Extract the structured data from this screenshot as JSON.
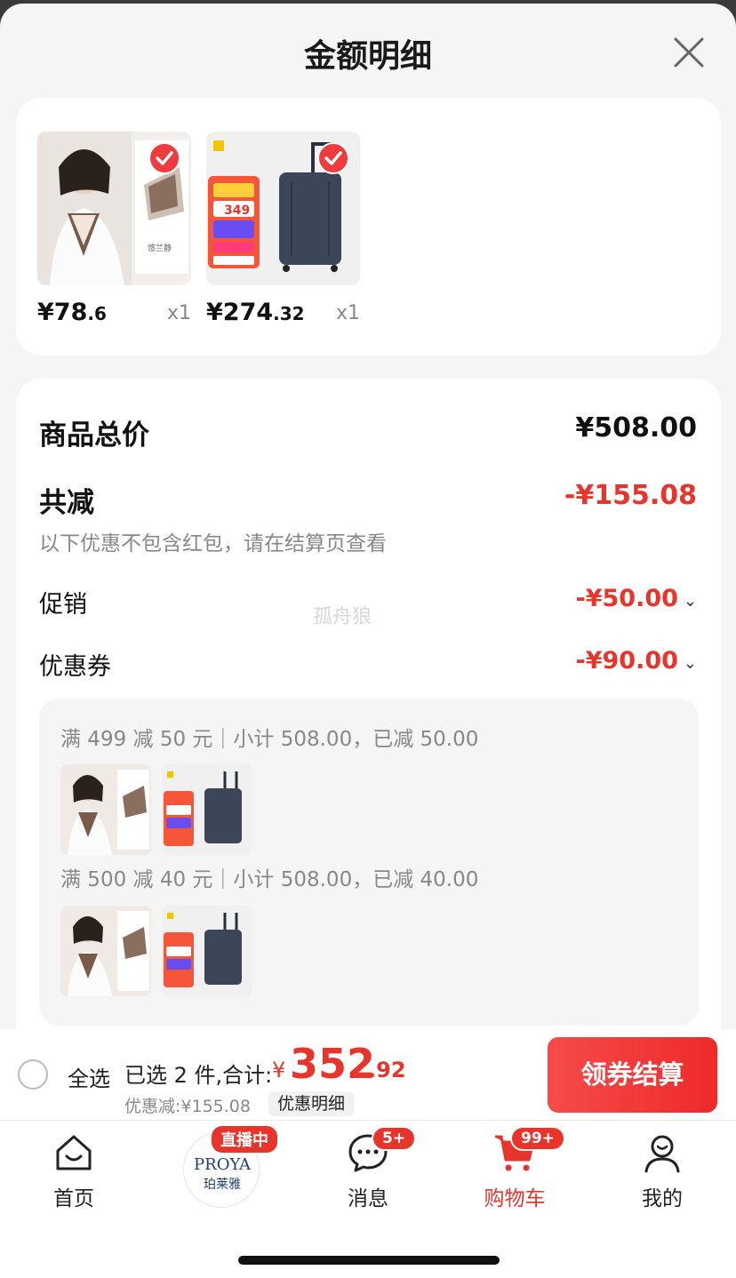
{
  "sheet": {
    "title": "金额明细",
    "close_icon": "close-icon"
  },
  "products": [
    {
      "price_int": "¥78",
      "price_dec": ".6",
      "qty": "x1",
      "image": "silk-scarf-model-image",
      "checked": true
    },
    {
      "price_int": "¥274",
      "price_dec": ".32",
      "qty": "x1",
      "image": "luggage-suitcase-image",
      "checked": true
    }
  ],
  "summary": {
    "total_label": "商品总价",
    "total_value": "¥508.00",
    "reduce_label": "共减",
    "reduce_value": "-¥155.08",
    "reduce_note": "以下优惠不包含红包，请在结算页查看",
    "promo_label": "促销",
    "promo_value": "-¥50.00",
    "coupon_label": "优惠券",
    "coupon_value": "-¥90.00",
    "watermark": "孤舟狼"
  },
  "coupon_details": [
    {
      "text": "满 499 减 50 元｜小计 508.00，已减 50.00"
    },
    {
      "text": "满 500 减 40 元｜小计 508.00，已减 40.00"
    }
  ],
  "bottom_bar": {
    "select_all": "全选",
    "selected_label": "已选 2 件,合计:",
    "currency": "¥",
    "total_int": "352",
    "total_dec": ".92",
    "discount_label": "优惠减:¥155.08",
    "discount_detail_button": "优惠明细",
    "checkout_button": "领券结算"
  },
  "tabbar": {
    "home": "首页",
    "live_badge": "直播中",
    "live_brand": "PROYA",
    "live_brand_cn": "珀莱雅",
    "messages": "消息",
    "messages_badge": "5+",
    "cart": "购物车",
    "cart_badge": "99+",
    "mine": "我的"
  },
  "colors": {
    "accent_red": "#e8352b",
    "sheet_bg": "#f5f5f5",
    "card_bg": "#ffffff"
  }
}
